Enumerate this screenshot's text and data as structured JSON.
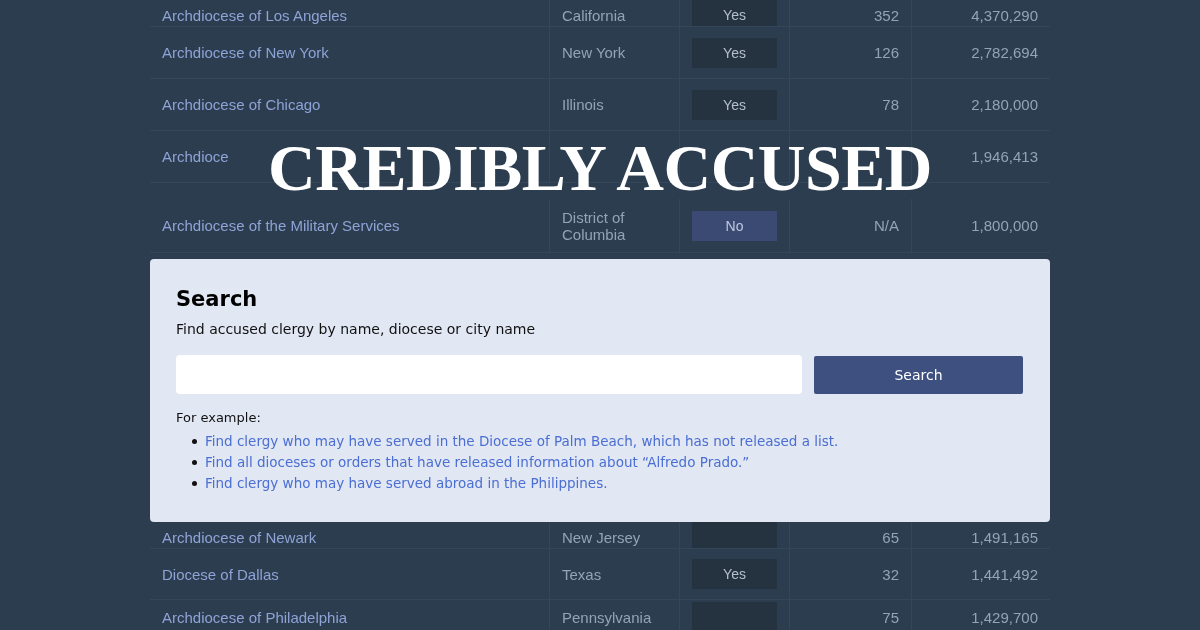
{
  "page_title": "CREDIBLY ACCUSED",
  "table_top": {
    "rows": [
      {
        "diocese": "Archdiocese of Los Angeles",
        "state": "California",
        "released": true,
        "released_label": "Yes",
        "accused": "352",
        "catholics": "4,370,290"
      },
      {
        "diocese": "Archdiocese of New York",
        "state": "New York",
        "released": true,
        "released_label": "Yes",
        "accused": "126",
        "catholics": "2,782,694"
      },
      {
        "diocese": "Archdiocese of Chicago",
        "state": "Illinois",
        "released": true,
        "released_label": "Yes",
        "accused": "78",
        "catholics": "2,180,000"
      },
      {
        "diocese": "Archdioce",
        "catholics": "1,946,413"
      },
      {
        "diocese": "Archdiocese of the Military Services",
        "state": "District of Columbia",
        "released": false,
        "released_label": "No",
        "accused": "N/A",
        "catholics": "1,800,000"
      }
    ]
  },
  "search": {
    "heading": "Search",
    "description": "Find accused clergy by name, diocese or city name",
    "button": "Search",
    "examples_label": "For example:",
    "examples": [
      "Find clergy who may have served in the Diocese of Palm Beach, which has not released a list.",
      "Find all dioceses or orders that have released information about “Alfredo Prado.”",
      "Find clergy who may have served abroad in the Philippines."
    ]
  },
  "table_bottom": {
    "rows": [
      {
        "diocese": "Archdiocese of Newark",
        "state": "New Jersey",
        "released": true,
        "accused": "65",
        "catholics": "1,491,165"
      },
      {
        "diocese": "Diocese of Dallas",
        "state": "Texas",
        "released": true,
        "released_label": "Yes",
        "accused": "32",
        "catholics": "1,441,492"
      },
      {
        "diocese": "Archdiocese of Philadelphia",
        "state": "Pennsylvania",
        "released": true,
        "accused": "75",
        "catholics": "1,429,700"
      }
    ]
  }
}
